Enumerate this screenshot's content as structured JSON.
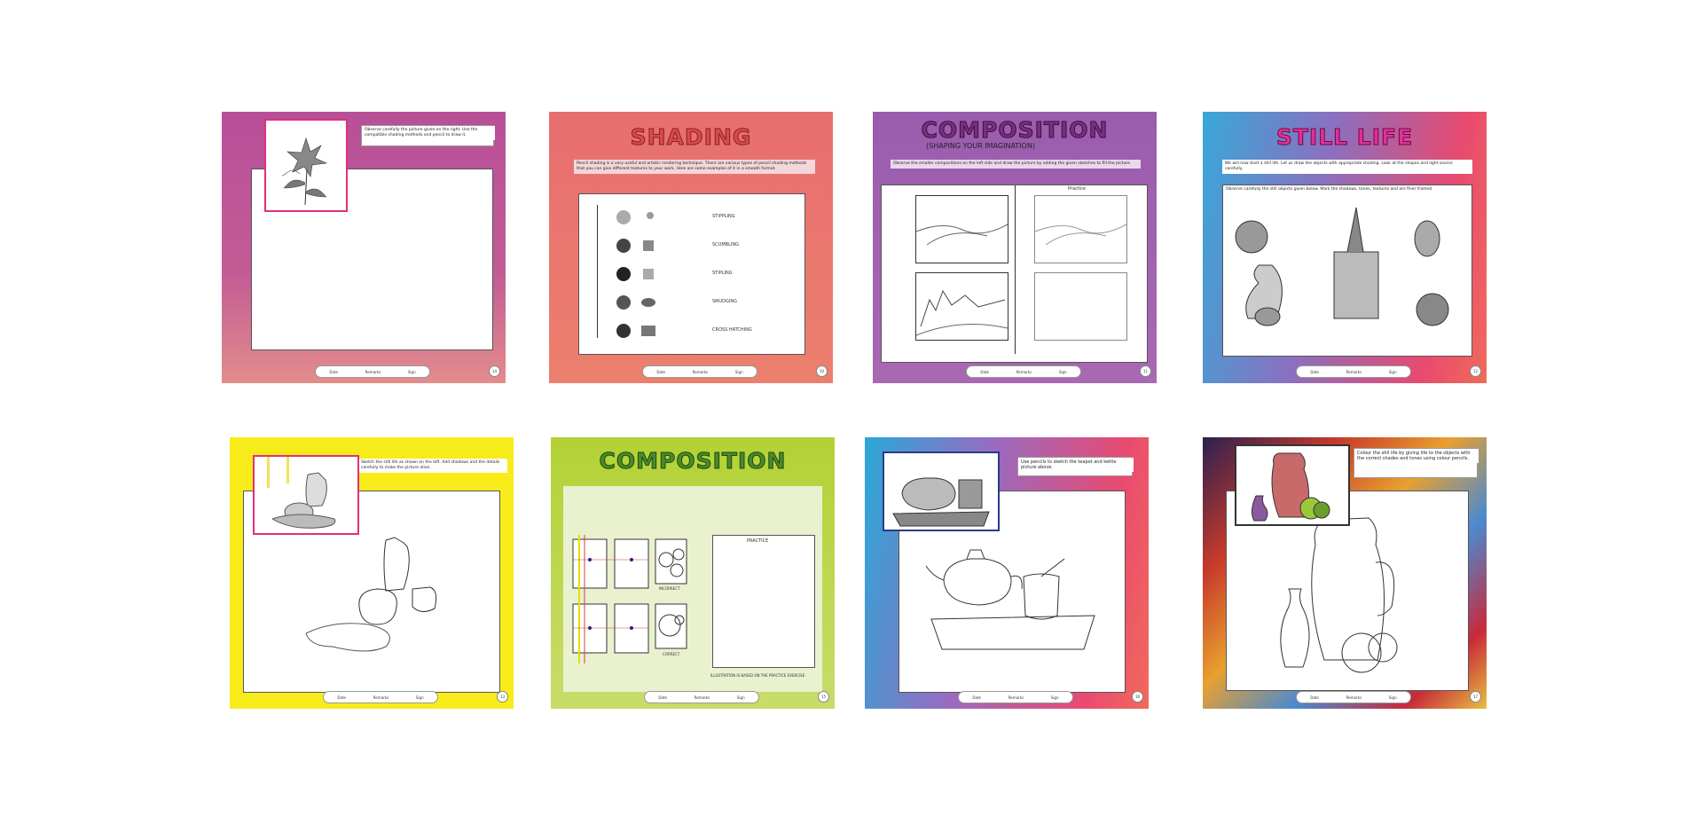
{
  "pages": [
    {
      "id": "flower",
      "instruction": "Observe carefully the picture given on the right. Use the compatible shading methods and pencil to draw it.",
      "footer": [
        "Date",
        "Remarks",
        "Sign"
      ],
      "page_number": "14",
      "colors": {
        "bg_top": "#b84f99",
        "bg_bottom": "#d06a8e",
        "accent": "#e0307a"
      }
    },
    {
      "id": "shading",
      "title": "SHADING",
      "instruction": "Pencil shading is a very useful and artistic rendering technique. There are various types of pencil shading methods that you can give different textures to your work. Here are some examples of it in a smooth format.",
      "techniques": [
        "STIPPLING",
        "SCUMBLING",
        "STIPLING",
        "SMUDGING",
        "CROSS HATCHING"
      ],
      "footer": [
        "Date",
        "Remarks",
        "Sign"
      ],
      "page_number": "10",
      "colors": {
        "bg": "#e8746e",
        "title": "#d94a4a"
      }
    },
    {
      "id": "composition-1",
      "title": "COMPOSITION",
      "subtitle": "(SHAPING YOUR IMAGINATION)",
      "instruction": "Observe the smaller compositions on the left side and draw the picture by adding the given sketches to fill the picture.",
      "practice_label": "Practice",
      "footer": [
        "Date",
        "Remarks",
        "Sign"
      ],
      "page_number": "11",
      "colors": {
        "bg": "#a060b0",
        "title": "#7a2e7e"
      }
    },
    {
      "id": "still-life-1",
      "title": "STILL LIFE",
      "instruction": "We will now start a still life. Let us draw the objects with appropriate shading. Look at the shapes and light source carefully.",
      "instruction2": "Observe carefully the still objects given below. Mark the shadows, tones, textures and are finer framed.",
      "footer": [
        "Date",
        "Remarks",
        "Sign"
      ],
      "page_number": "12",
      "colors": {
        "bg_left": "#3aa8d8",
        "bg_right": "#e83a6a",
        "title": "#e0309a"
      }
    },
    {
      "id": "still-life-2",
      "instruction": "Sketch the still life as shown on the left. Add shadows and the details carefully to make the picture alive.",
      "footer": [
        "Date",
        "Remarks",
        "Sign"
      ],
      "page_number": "13",
      "colors": {
        "bg": "#f7ec1a",
        "accent": "#e0307a"
      }
    },
    {
      "id": "composition-2",
      "title": "COMPOSITION",
      "labels": [
        "INCORRECT",
        "CORRECT"
      ],
      "practice_label": "PRACTICE",
      "footer_note": "ILLUSTRATION IS BASED ON THE PRACTICE EXERCISE",
      "footer": [
        "Date",
        "Remarks",
        "Sign"
      ],
      "page_number": "15",
      "colors": {
        "bg": "#b5d235",
        "title": "#4a8a2a"
      }
    },
    {
      "id": "teapot",
      "instruction": "Use pencils to sketch the teapot and kettle picture above.",
      "footer": [
        "Date",
        "Remarks",
        "Sign"
      ],
      "page_number": "16",
      "colors": {
        "bg_left": "#3aa8d8",
        "bg_right": "#e8486a",
        "frame": "#2a3a8a"
      }
    },
    {
      "id": "jug",
      "instruction": "Colour the still life by giving life to the objects with the correct shades and tones using colour pencils.",
      "footer": [
        "Date",
        "Remarks",
        "Sign"
      ],
      "page_number": "17",
      "colors": {
        "bg": "#c83a2a",
        "frame": "#333333"
      }
    }
  ]
}
